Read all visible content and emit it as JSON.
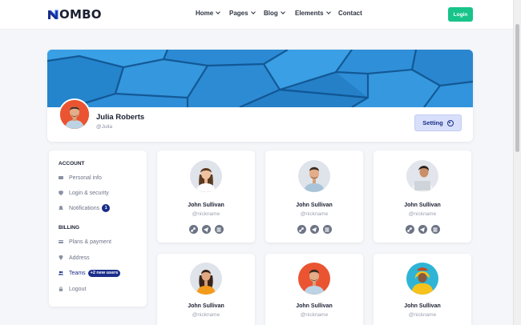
{
  "brand": {
    "logo_text": "OMBO",
    "accent": "#1a2d8a"
  },
  "nav": {
    "items": [
      {
        "label": "Home",
        "has_dropdown": true
      },
      {
        "label": "Pages",
        "has_dropdown": true
      },
      {
        "label": "Blog",
        "has_dropdown": true
      },
      {
        "label": "Elements",
        "has_dropdown": true
      },
      {
        "label": "Contact",
        "has_dropdown": false
      }
    ],
    "login_label": "Login",
    "login_color": "#18c48a"
  },
  "profile": {
    "name": "Julia Roberts",
    "handle": "@Julia",
    "setting_label": "Setting",
    "cover_color": "#2e8fd8"
  },
  "sidebar": {
    "account_title": "ACCOUNT",
    "account_items": [
      {
        "label": "Personal info",
        "icon": "id-card-icon"
      },
      {
        "label": "Login & security",
        "icon": "shield-icon"
      },
      {
        "label": "Notifications",
        "icon": "bell-icon",
        "badge": "1"
      }
    ],
    "billing_title": "BILLING",
    "billing_items": [
      {
        "label": "Plans & payment",
        "icon": "card-icon"
      },
      {
        "label": "Address",
        "icon": "map-pin-icon"
      },
      {
        "label": "Teams",
        "icon": "users-icon",
        "badge": "+2 new users",
        "active": true
      },
      {
        "label": "Logout",
        "icon": "lock-icon"
      }
    ]
  },
  "users": [
    {
      "name": "John Sullivan",
      "handle": "@nickname",
      "avatar_bg": "#dfe3ea",
      "shirt": "#ffffff",
      "hair": "#5a3b22"
    },
    {
      "name": "John Sullivan",
      "handle": "@nickname",
      "avatar_bg": "#dfe3ea",
      "shirt": "#a9c4d8",
      "hair": "#3c2c22"
    },
    {
      "name": "John Sullivan",
      "handle": "@nickname",
      "avatar_bg": "#e2e6ec",
      "shirt": "#f2f2f2",
      "hair": "#2a211c"
    },
    {
      "name": "John Sullivan",
      "handle": "@nickname",
      "avatar_bg": "#dfe3ea",
      "shirt": "#f39b1c",
      "hair": "#3a2418"
    },
    {
      "name": "John Sullivan",
      "handle": "@nickname",
      "avatar_bg": "#ea5431",
      "shirt": "#bcd3e4",
      "hair": "#3c2c22"
    },
    {
      "name": "John Sullivan",
      "handle": "@nickname",
      "avatar_bg": "#2fb4d6",
      "shirt": "#f7c21b",
      "hair": "#c24b22"
    }
  ],
  "social_icons": [
    "link-icon",
    "telegram-icon",
    "grid-icon"
  ]
}
